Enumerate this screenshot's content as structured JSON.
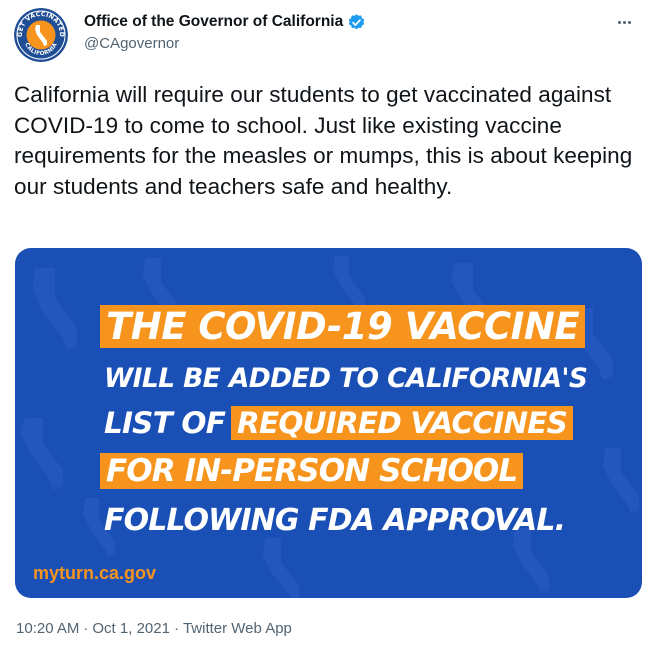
{
  "tweet": {
    "author": {
      "display_name": "Office of the Governor of California",
      "handle": "@CAgovernor",
      "verified": true,
      "avatar_icon": "california-vaccine-seal-icon",
      "avatar_text_top": "GET VACCINATED",
      "avatar_text_bottom": "CALIFORNIA"
    },
    "more_icon": "more-options-icon",
    "text": "California will require our students to get vaccinated against COVID-19 to come to school. Just like existing vaccine requirements for the measles or mumps, this is about keeping our students and teachers safe and healthy.",
    "media": {
      "line1": "THE COVID-19 VACCINE",
      "line2": "WILL BE ADDED TO CALIFORNIA'S",
      "line3_plain": "LIST OF",
      "line3_highlight": "REQUIRED VACCINES",
      "line4": "FOR IN-PERSON SCHOOL",
      "line5": "FOLLOWING FDA APPROVAL.",
      "site": "myturn.ca.gov",
      "colors": {
        "background": "#1a4fb6",
        "highlight": "#f7941d",
        "text": "#ffffff"
      }
    },
    "timestamp_time": "10:20 AM",
    "timestamp_date": "Oct 1, 2021",
    "source": "Twitter Web App",
    "separator": "·"
  },
  "colors": {
    "text_primary": "#0f1419",
    "text_secondary": "#536471",
    "verified_blue": "#1d9bf0"
  }
}
